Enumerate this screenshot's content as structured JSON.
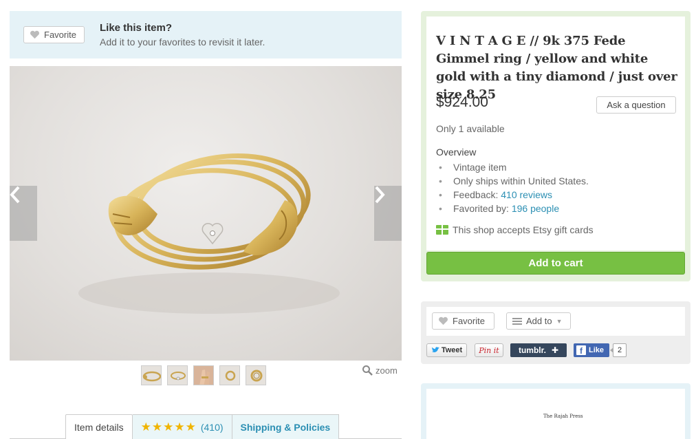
{
  "favorite_banner": {
    "button_label": "Favorite",
    "title": "Like this item?",
    "subtitle": "Add it to your favorites to revisit it later."
  },
  "gallery": {
    "zoom_label": "zoom",
    "thumbnail_count": 5
  },
  "tabs": {
    "details": "Item details",
    "reviews_count": "(410)",
    "reviews_stars": 5,
    "shipping": "Shipping & Policies"
  },
  "listing": {
    "title": "V I N T A G E // 9k 375 Fede Gimmel ring / yellow and white gold with a tiny diamond / just over size 8.25",
    "price": "$924.00",
    "ask_button": "Ask a question",
    "availability": "Only 1 available",
    "overview_heading": "Overview",
    "overview": {
      "vintage": "Vintage item",
      "ships": "Only ships within United States.",
      "feedback_label": "Feedback: ",
      "feedback_link": "410 reviews",
      "favorited_label": "Favorited by: ",
      "favorited_link": "196 people"
    },
    "gift_cards": "This shop accepts Etsy gift cards",
    "add_to_cart": "Add to cart"
  },
  "social": {
    "favorite": "Favorite",
    "add_to": "Add to",
    "tweet": "Tweet",
    "pinit": "Pin it",
    "tumblr": "tumblr.",
    "like": "Like",
    "like_count": "2"
  },
  "shop": {
    "banner_text": "The Rajah Press"
  },
  "colors": {
    "accent_link": "#2b8fb3",
    "cart_green": "#77c043",
    "star_gold": "#f0b400"
  }
}
